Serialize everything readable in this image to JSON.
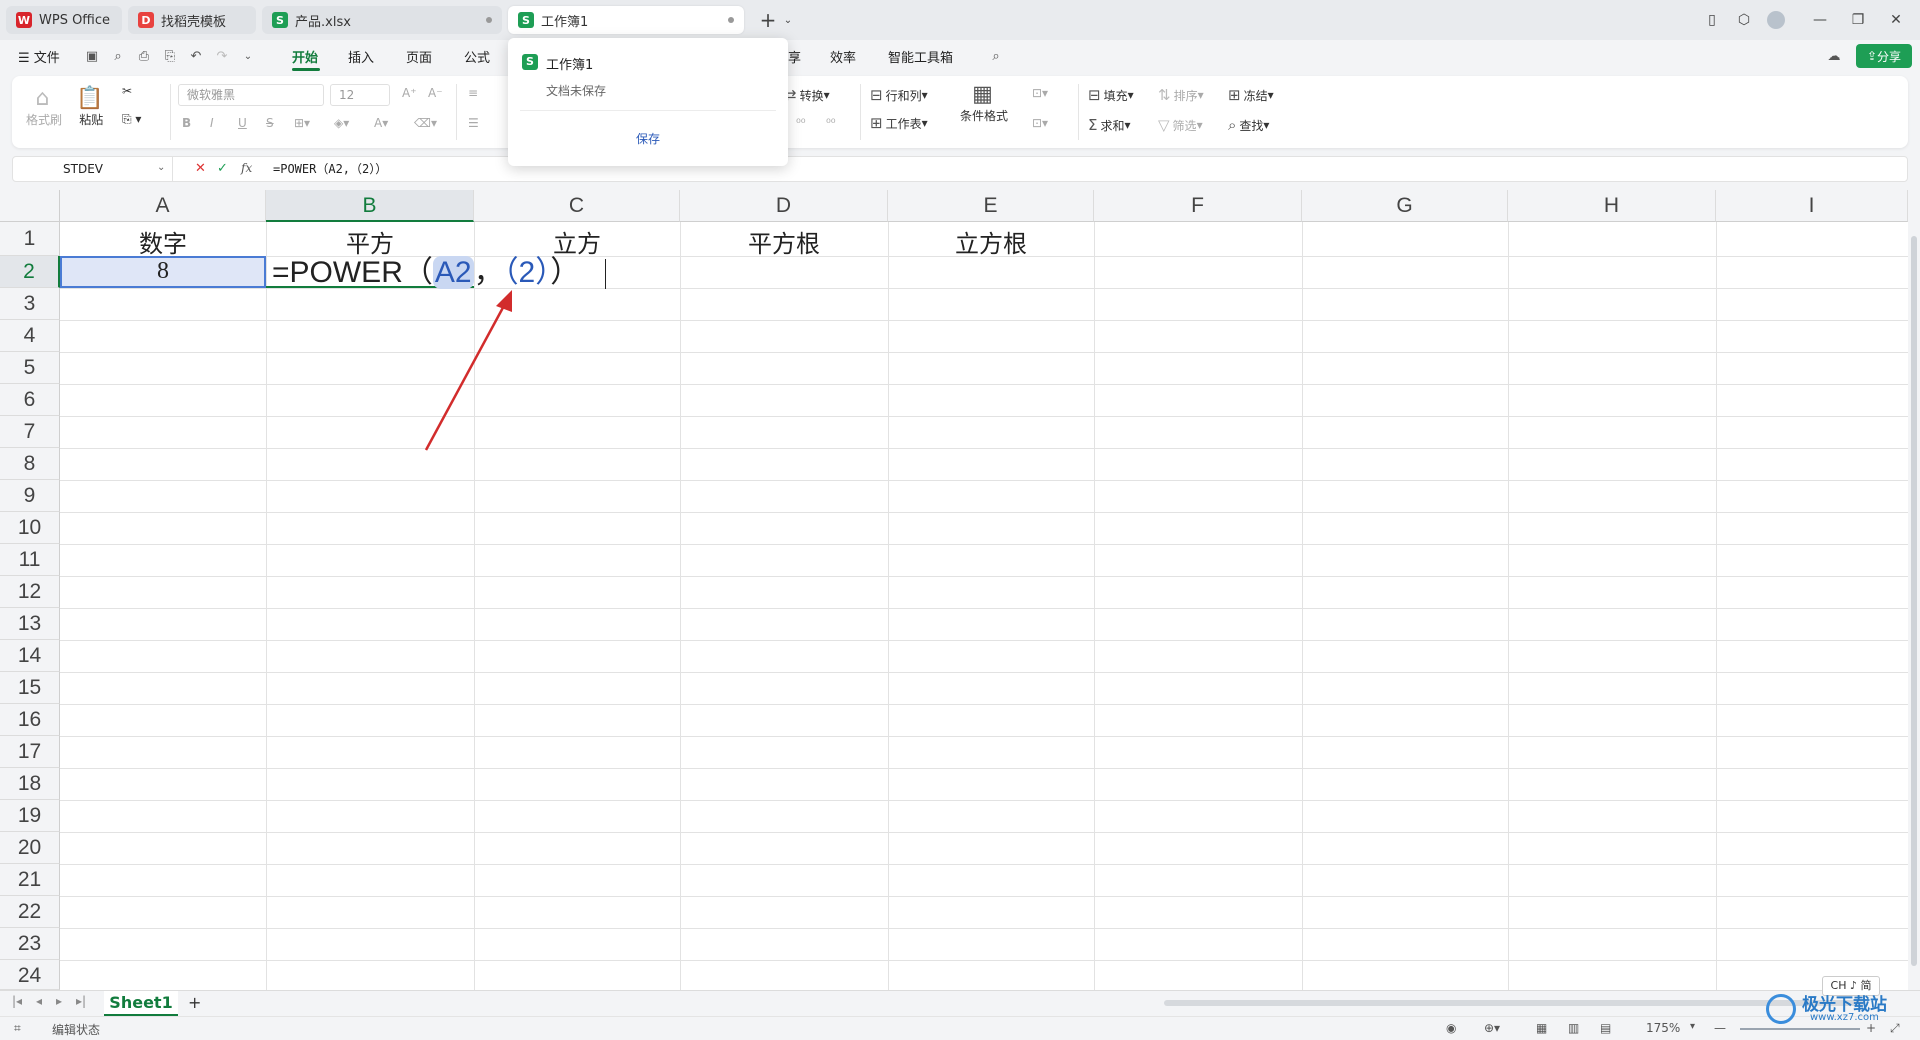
{
  "tabs": [
    {
      "label": "WPS Office",
      "color": "#d8252c"
    },
    {
      "label": "找稻壳模板",
      "color": "#e8423f"
    },
    {
      "label": "产品.xlsx",
      "color": "#1e9e55"
    },
    {
      "label": "工作簿1",
      "color": "#1e9e55"
    }
  ],
  "menu": {
    "file": "文件",
    "items": [
      "开始",
      "插入",
      "页面",
      "公式",
      "享",
      "效率",
      "智能工具箱"
    ],
    "active": "开始",
    "share": "分享"
  },
  "ribbon": {
    "format_painter": "格式刷",
    "paste": "粘贴",
    "font_name": "微软雅黑",
    "font_size": "12",
    "bold": "B",
    "italic": "I",
    "underline": "U",
    "strike": "S",
    "convert": "转换",
    "row_col": "行和列",
    "worksheet": "工作表",
    "cond_format": "条件格式",
    "fill": "填充",
    "sort": "排序",
    "freeze": "冻结",
    "sum": "求和",
    "filter": "筛选",
    "find": "查找"
  },
  "formula_bar": {
    "name_box": "STDEV",
    "formula": "=POWER（A2,（2））",
    "fx": "fx"
  },
  "popup": {
    "title": "工作簿1",
    "subtitle": "文档未保存",
    "save": "保存"
  },
  "columns": [
    "A",
    "B",
    "C",
    "D",
    "E",
    "F",
    "G",
    "H",
    "I"
  ],
  "rows": [
    "1",
    "2",
    "3",
    "4",
    "5",
    "6",
    "7",
    "8",
    "9",
    "10",
    "11",
    "12",
    "13",
    "14",
    "15",
    "16",
    "17",
    "18",
    "19",
    "20",
    "21",
    "22",
    "23",
    "24"
  ],
  "cells": {
    "A1": "数字",
    "B1": "平方",
    "C1": "立方",
    "D1": "平方根",
    "E1": "立方根",
    "A2": "8",
    "B2_prefix": "=POWER（",
    "B2_ref": "A2",
    "B2_sep": "，",
    "B2_arg": "（2）",
    "B2_suffix": "）"
  },
  "sheet": {
    "name": "Sheet1",
    "add": "+"
  },
  "status": {
    "mode": "编辑状态",
    "zoom": "175%",
    "ime": "CH ♪ 简",
    "watermark": "极光下载站",
    "watermark_url": "www.xz7.com"
  },
  "colors": {
    "accent": "#127c3d",
    "selection": "#4a7bd4",
    "arrow": "#d22c2c"
  }
}
